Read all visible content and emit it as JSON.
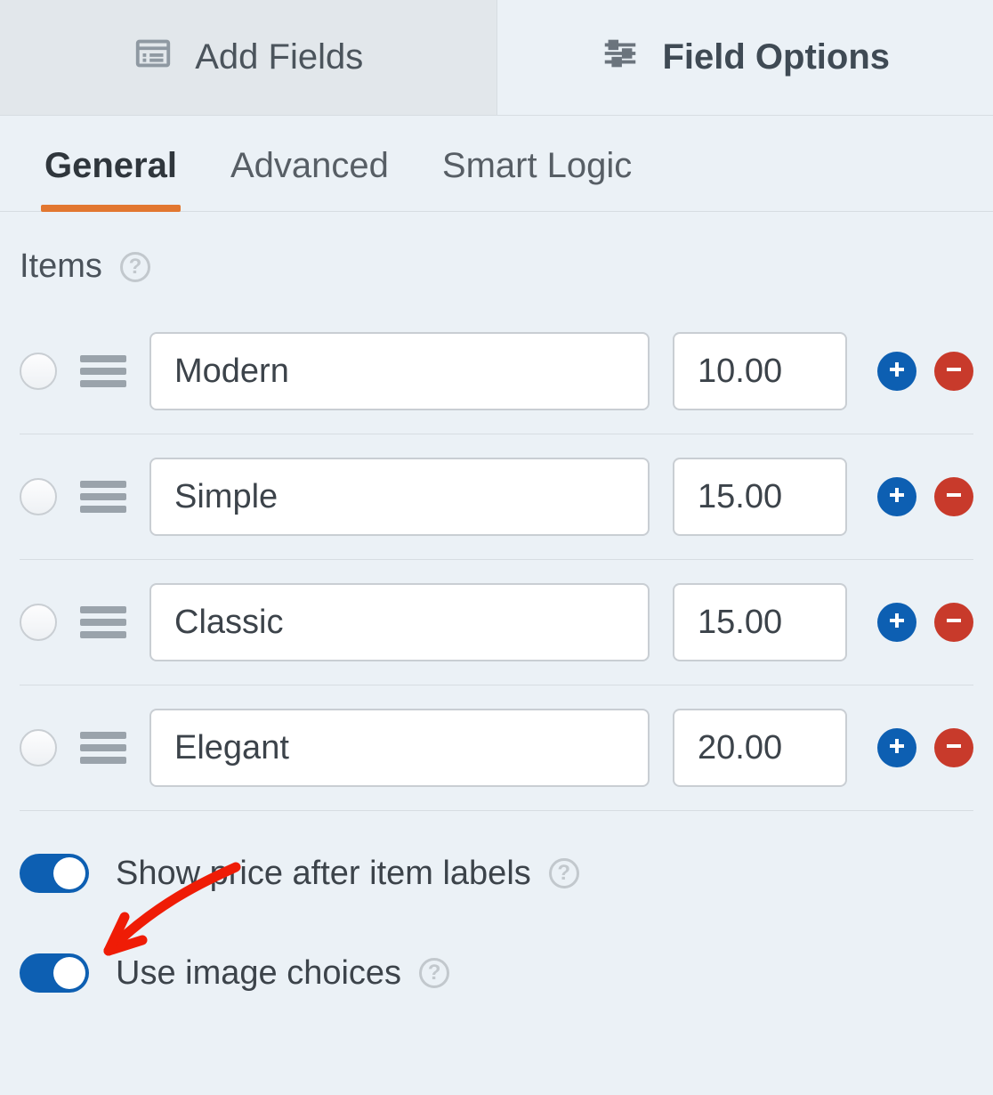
{
  "colors": {
    "accent_orange": "#e27730",
    "accent_blue": "#0d5fb2",
    "accent_red": "#c83a2b"
  },
  "top_tabs": [
    {
      "label": "Add Fields",
      "active": false
    },
    {
      "label": "Field Options",
      "active": true
    }
  ],
  "sub_tabs": [
    {
      "label": "General",
      "active": true
    },
    {
      "label": "Advanced",
      "active": false
    },
    {
      "label": "Smart Logic",
      "active": false
    }
  ],
  "section": {
    "title": "Items"
  },
  "items": [
    {
      "label": "Modern",
      "price": "10.00"
    },
    {
      "label": "Simple",
      "price": "15.00"
    },
    {
      "label": "Classic",
      "price": "15.00"
    },
    {
      "label": "Elegant",
      "price": "20.00"
    }
  ],
  "toggles": {
    "show_price": {
      "label": "Show price after item labels",
      "on": true
    },
    "image_choices": {
      "label": "Use image choices",
      "on": true
    }
  }
}
